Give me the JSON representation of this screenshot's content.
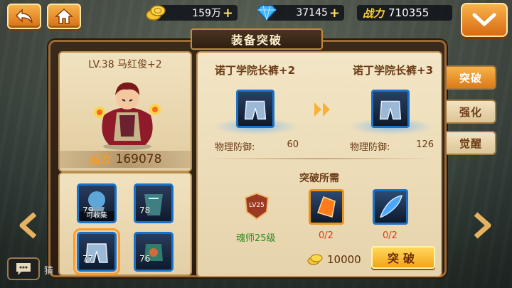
{
  "topbar": {
    "gold": "159万",
    "diamonds": "37145",
    "power_label": "战力",
    "power_value": "710355"
  },
  "panel": {
    "title": "装备突破"
  },
  "hero": {
    "level_name": "LV.38  马红俊+2",
    "power_label": "战力",
    "power_value": "169078"
  },
  "equipment_slots": [
    {
      "level": "79",
      "caption": "可收集"
    },
    {
      "level": "78",
      "caption": ""
    },
    {
      "level": "77",
      "caption": "",
      "selected": true
    },
    {
      "level": "76",
      "caption": ""
    }
  ],
  "breakthrough": {
    "current_name": "诺丁学院长裤+2",
    "next_name": "诺丁学院长裤+3",
    "stat_label": "物理防御:",
    "current_stat": "60",
    "next_stat": "126",
    "requirements_title": "突破所需",
    "req_level_badge": "LV25",
    "req_level_text": "魂师25级",
    "material1_count": "0/2",
    "material2_count": "0/2",
    "cost": "10000",
    "button_label": "突破"
  },
  "side_tabs": [
    {
      "label": "突破",
      "active": true
    },
    {
      "label": "强化",
      "active": false
    },
    {
      "label": "觉醒",
      "active": false
    }
  ],
  "chat": {
    "preview": "猜"
  }
}
